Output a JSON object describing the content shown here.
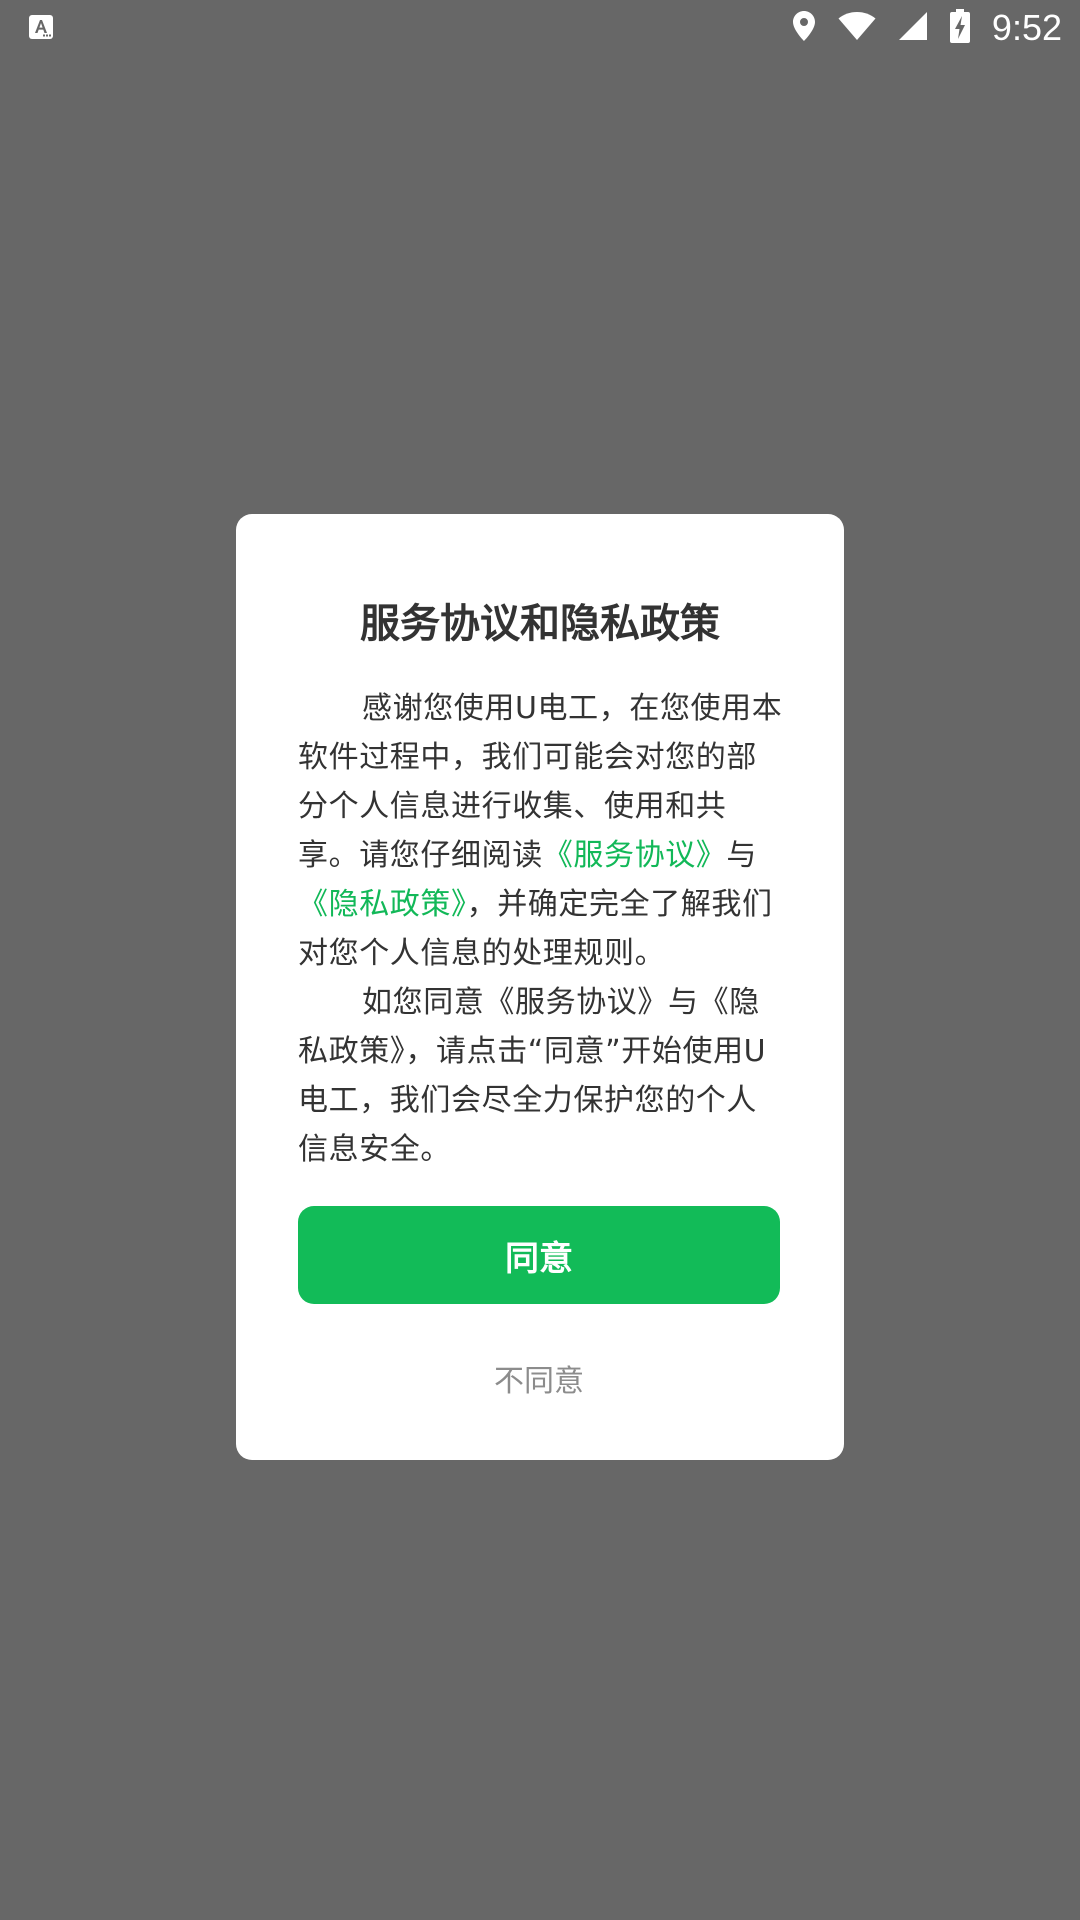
{
  "status_bar": {
    "time": "9:52",
    "icons": [
      "text-notification-icon",
      "location-icon",
      "wifi-icon",
      "signal-icon",
      "battery-charging-icon"
    ]
  },
  "dialog": {
    "title": "服务协议和隐私政策",
    "paragraph1": {
      "part1": "感谢您使用U电工，在您使用本软件过程中，我们可能会对您的部分个人信息进行收集、使用和共享。请您仔细阅读",
      "link_service": "《服务协议》",
      "part2": "与",
      "link_privacy": "《隐私政策》",
      "part3": "，并确定完全了解我们对您个人信息的处理规则。"
    },
    "paragraph2": "如您同意《服务协议》与《隐私政策》，请点击“同意”开始使用U电工，我们会尽全力保护您的个人信息安全。",
    "agree_label": "同意",
    "disagree_label": "不同意"
  },
  "colors": {
    "overlay": "#676767",
    "accent": "#12bb58",
    "text": "#333333",
    "secondary_text": "#8c8c8c"
  }
}
